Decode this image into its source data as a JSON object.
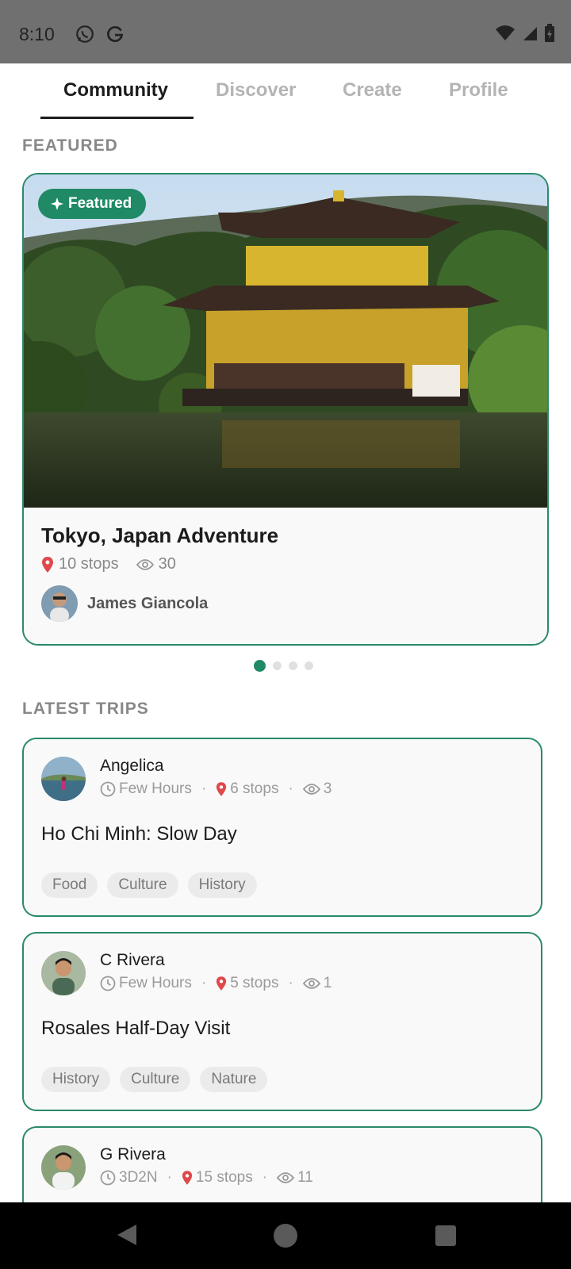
{
  "status_bar": {
    "time": "8:10"
  },
  "tabs": [
    {
      "label": "Community",
      "active": true
    },
    {
      "label": "Discover",
      "active": false
    },
    {
      "label": "Create",
      "active": false
    },
    {
      "label": "Profile",
      "active": false
    }
  ],
  "featured_section": {
    "label": "FEATURED",
    "card": {
      "badge": "Featured",
      "title": "Tokyo, Japan Adventure",
      "stops": "10 stops",
      "views": "30",
      "author": "James Giancola"
    },
    "carousel": {
      "current": 1,
      "total": 4
    }
  },
  "latest_section": {
    "label": "LATEST TRIPS",
    "trips": [
      {
        "author": "Angelica",
        "duration": "Few Hours",
        "stops": "6 stops",
        "views": "3",
        "title": "Ho Chi Minh: Slow Day",
        "tags": [
          "Food",
          "Culture",
          "History"
        ]
      },
      {
        "author": "C Rivera",
        "duration": "Few Hours",
        "stops": "5 stops",
        "views": "1",
        "title": "Rosales Half-Day Visit",
        "tags": [
          "History",
          "Culture",
          "Nature"
        ]
      },
      {
        "author": "G Rivera",
        "duration": "3D2N",
        "stops": "15 stops",
        "views": "11"
      }
    ]
  },
  "colors": {
    "accent": "#1f8a65",
    "card_border": "#2a8a6a",
    "pin": "#e0484a"
  }
}
